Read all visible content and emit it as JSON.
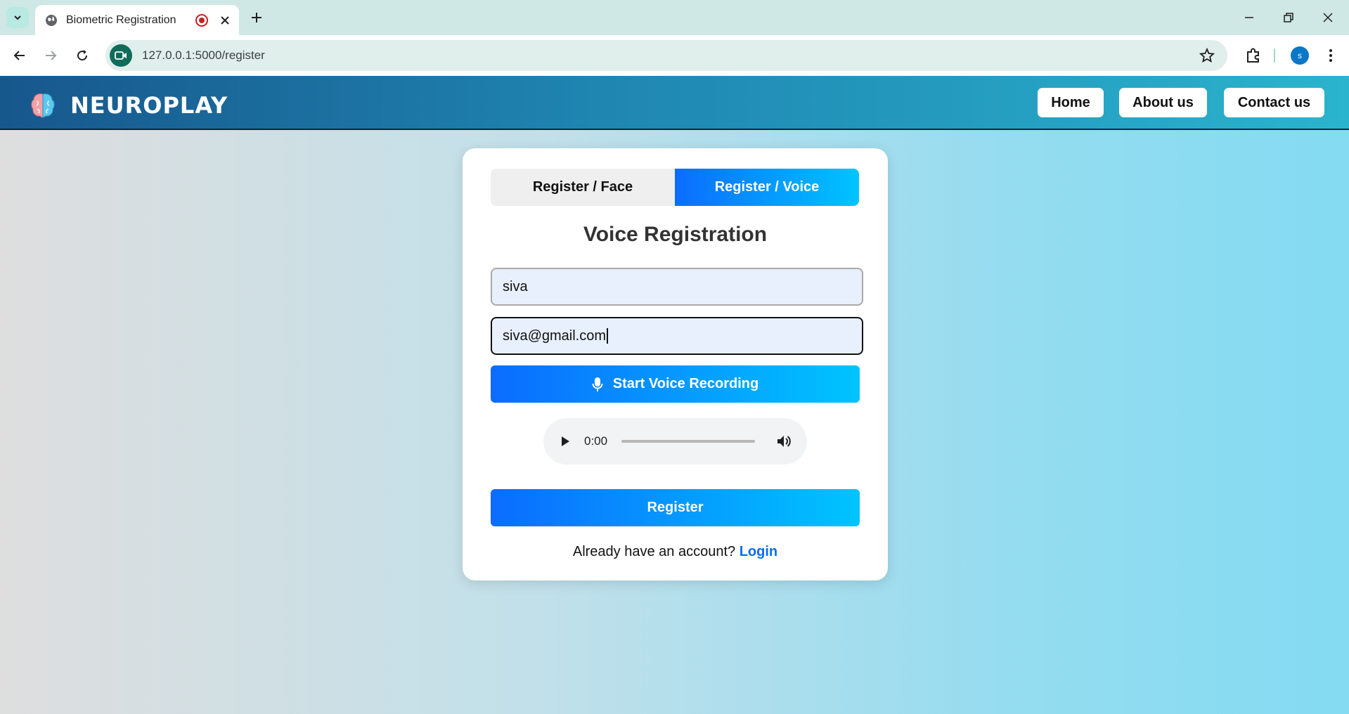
{
  "browser": {
    "tab_title": "Biometric Registration",
    "url": "127.0.0.1:5000/register",
    "profile_initial": "s"
  },
  "header": {
    "logo_text": "NEUROPLAY",
    "nav": [
      "Home",
      "About us",
      "Contact us"
    ]
  },
  "form": {
    "tabs": [
      "Register / Face",
      "Register / Voice"
    ],
    "active_tab": "Register / Voice",
    "heading": "Voice Registration",
    "name_value": "siva",
    "email_value": "siva@gmail.com",
    "record_button": "Start Voice Recording",
    "audio_time": "0:00",
    "register_button": "Register",
    "footer_text": "Already have an account?",
    "login_link": "Login"
  },
  "colors": {
    "accent_start": "#0b6cff",
    "accent_end": "#00c4ff",
    "header_start": "#17578c",
    "header_end": "#2ab4cd",
    "link": "#0b6cf0"
  }
}
